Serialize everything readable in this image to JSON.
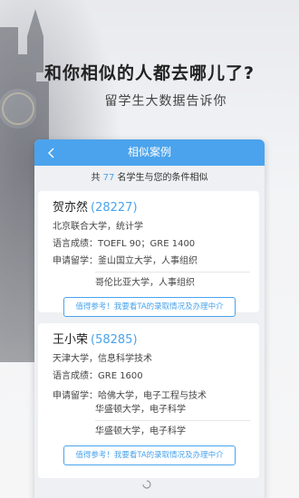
{
  "promo": {
    "headline": "和你相似的人都去哪儿了?",
    "subline": "留学生大数据告诉你"
  },
  "app": {
    "title": "相似案例",
    "summary": {
      "prefix": "共",
      "count": "77",
      "suffix": "名学生与您的条件相似"
    },
    "cases": [
      {
        "name": "贺亦然",
        "id": "(28227)",
        "school": "北京联合大学，统计学",
        "scores_label": "语言成绩：",
        "scores": "TOEFL 90；GRE 1400",
        "apply_label": "申请留学：",
        "applications": [
          "釜山国立大学，人事组织",
          "哥伦比亚大学，人事组织"
        ],
        "cta": "值得参考！我要看TA的录取情况及办理中介"
      },
      {
        "name": "王小荣",
        "id": "(58285)",
        "school": "天津大学，信息科学技术",
        "scores_label": "语言成绩：",
        "scores": "GRE 1600",
        "apply_label": "申请留学：",
        "applications": [
          "哈佛大学，电子工程与技术",
          "华盛顿大学，电子科学",
          "华盛顿大学，电子科学"
        ],
        "cta": "值得参考！我要看TA的录取情况及办理中介"
      }
    ]
  },
  "colors": {
    "accent": "#4aa3ec",
    "background": "#eef0f3"
  },
  "icons": {
    "back": "chevron-left-icon",
    "loading": "spinner-icon"
  }
}
